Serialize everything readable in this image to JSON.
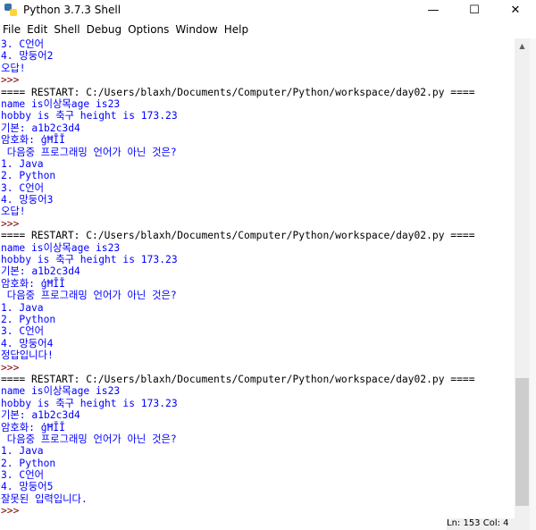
{
  "window": {
    "title": "Python 3.7.3 Shell",
    "controls": {
      "minimize": "—",
      "maximize": "☐",
      "close": "✕"
    }
  },
  "menu": [
    "File",
    "Edit",
    "Shell",
    "Debug",
    "Options",
    "Window",
    "Help"
  ],
  "shell_lines": [
    {
      "text": "3. C언어",
      "kind": "out"
    },
    {
      "text": "4. 망둥어2",
      "kind": "out"
    },
    {
      "text": "오답!",
      "kind": "out"
    },
    {
      "text": ">>> ",
      "kind": "prompt"
    },
    {
      "text": "==== RESTART: C:/Users/blaxh/Documents/Computer/Python/workspace/day02.py ====",
      "kind": "restart"
    },
    {
      "text": "name is이상목age is23",
      "kind": "out"
    },
    {
      "text": "hobby is 축구 height is 173.23",
      "kind": "out"
    },
    {
      "text": "기본: a1b2c3d4",
      "kind": "out"
    },
    {
      "text": "암호화: ģĦĪĬ",
      "kind": "out"
    },
    {
      "text": " 다음중 프로그래밍 언어가 아닌 것은?",
      "kind": "out"
    },
    {
      "text": "1. Java",
      "kind": "out"
    },
    {
      "text": "2. Python",
      "kind": "out"
    },
    {
      "text": "3. C언어",
      "kind": "out"
    },
    {
      "text": "4. 망둥어3",
      "kind": "out"
    },
    {
      "text": "오답!",
      "kind": "out"
    },
    {
      "text": ">>> ",
      "kind": "prompt"
    },
    {
      "text": "==== RESTART: C:/Users/blaxh/Documents/Computer/Python/workspace/day02.py ====",
      "kind": "restart"
    },
    {
      "text": "name is이상목age is23",
      "kind": "out"
    },
    {
      "text": "hobby is 축구 height is 173.23",
      "kind": "out"
    },
    {
      "text": "기본: a1b2c3d4",
      "kind": "out"
    },
    {
      "text": "암호화: ģĦĪĬ",
      "kind": "out"
    },
    {
      "text": " 다음중 프로그래밍 언어가 아닌 것은?",
      "kind": "out"
    },
    {
      "text": "1. Java",
      "kind": "out"
    },
    {
      "text": "2. Python",
      "kind": "out"
    },
    {
      "text": "3. C언어",
      "kind": "out"
    },
    {
      "text": "4. 망둥어4",
      "kind": "out"
    },
    {
      "text": "정답입니다!",
      "kind": "out"
    },
    {
      "text": ">>> ",
      "kind": "prompt"
    },
    {
      "text": "==== RESTART: C:/Users/blaxh/Documents/Computer/Python/workspace/day02.py ====",
      "kind": "restart"
    },
    {
      "text": "name is이상목age is23",
      "kind": "out"
    },
    {
      "text": "hobby is 축구 height is 173.23",
      "kind": "out"
    },
    {
      "text": "기본: a1b2c3d4",
      "kind": "out"
    },
    {
      "text": "암호화: ģĦĪĬ",
      "kind": "out"
    },
    {
      "text": " 다음중 프로그래밍 언어가 아닌 것은?",
      "kind": "out"
    },
    {
      "text": "1. Java",
      "kind": "out"
    },
    {
      "text": "2. Python",
      "kind": "out"
    },
    {
      "text": "3. C언어",
      "kind": "out"
    },
    {
      "text": "4. 망둥어5",
      "kind": "out"
    },
    {
      "text": "잘못된 입력입니다.",
      "kind": "out"
    },
    {
      "text": ">>> ",
      "kind": "prompt"
    }
  ],
  "status": {
    "text": "Ln: 153  Col: 4"
  },
  "colors": {
    "output": "#0000ff",
    "prompt": "#8b0000",
    "restart": "#000000"
  }
}
